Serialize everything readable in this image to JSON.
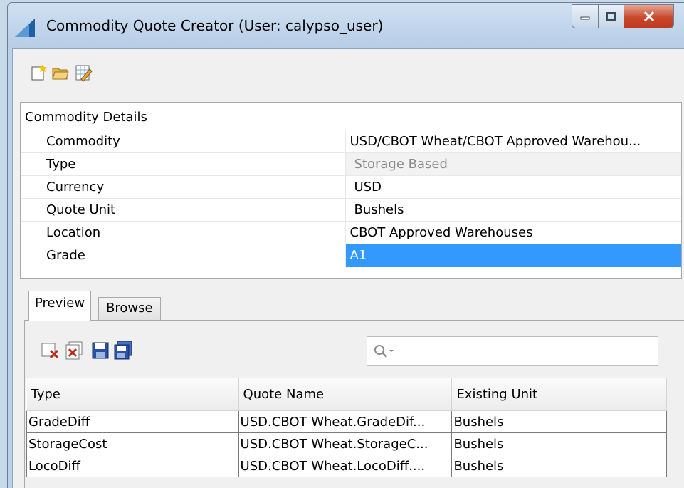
{
  "window": {
    "title": "Commodity Quote Creator (User: calypso_user)",
    "colors": {
      "accent": "#3399ff",
      "close": "#c9492d"
    }
  },
  "toolbar": {
    "icons": [
      "new-document-icon",
      "open-folder-icon",
      "edit-sheet-icon"
    ]
  },
  "details": {
    "header": "Commodity Details",
    "rows": [
      {
        "label": "Commodity",
        "value": "USD/CBOT Wheat/CBOT Approved Warehou..."
      },
      {
        "label": "Type",
        "value": "Storage Based"
      },
      {
        "label": "Currency",
        "value": "USD"
      },
      {
        "label": "Quote Unit",
        "value": "Bushels"
      },
      {
        "label": "Location",
        "value": "CBOT Approved Warehouses"
      },
      {
        "label": "Grade",
        "value": "A1"
      }
    ]
  },
  "tabs": [
    {
      "label": "Preview",
      "active": true
    },
    {
      "label": "Browse",
      "active": false
    }
  ],
  "preview": {
    "tools": [
      "delete-row-icon",
      "delete-all-icon",
      "save-icon",
      "save-all-icon"
    ],
    "search_placeholder": "",
    "columns": [
      "Type",
      "Quote Name",
      "Existing Unit"
    ],
    "rows": [
      [
        "GradeDiff",
        "USD.CBOT Wheat.GradeDif...",
        "Bushels"
      ],
      [
        "StorageCost",
        "USD.CBOT Wheat.StorageC...",
        "Bushels"
      ],
      [
        "LocoDiff",
        "USD.CBOT Wheat.LocoDiff....",
        "Bushels"
      ]
    ]
  }
}
